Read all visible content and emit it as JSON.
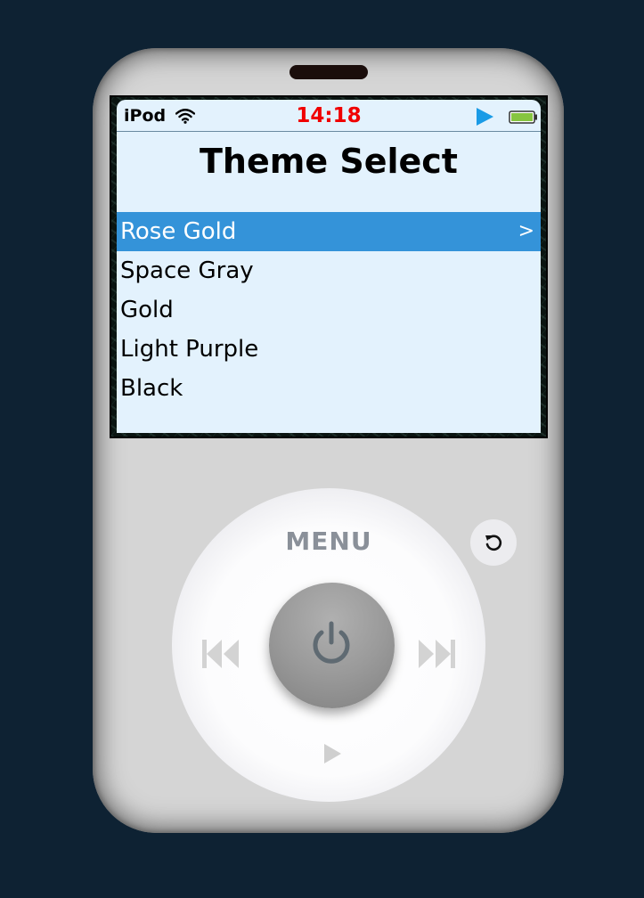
{
  "status_bar": {
    "brand": "iPod",
    "time": "14:18",
    "wifi_icon": "wifi-icon",
    "play_icon": "play-indicator-icon",
    "battery_icon": "battery-icon",
    "time_color": "#f00000",
    "play_color": "#1a9be6"
  },
  "screen": {
    "title": "Theme Select",
    "items": [
      {
        "label": "Rose Gold",
        "selected": true,
        "chevron": ">"
      },
      {
        "label": "Space Gray",
        "selected": false
      },
      {
        "label": "Gold",
        "selected": false
      },
      {
        "label": "Light Purple",
        "selected": false
      },
      {
        "label": "Black",
        "selected": false
      }
    ],
    "selected_color": "#3493d9",
    "background_color": "#e3f2fd"
  },
  "wheel": {
    "menu_label": "MENU",
    "prev_icon": "previous-track-icon",
    "next_icon": "next-track-icon",
    "play_icon": "play-icon",
    "center_icon": "power-icon"
  },
  "reset_button": {
    "icon": "reset-icon"
  },
  "colors": {
    "page_background": "#0e2233",
    "device_body": "#d5d5d5",
    "menu_label": "#8a9099"
  }
}
